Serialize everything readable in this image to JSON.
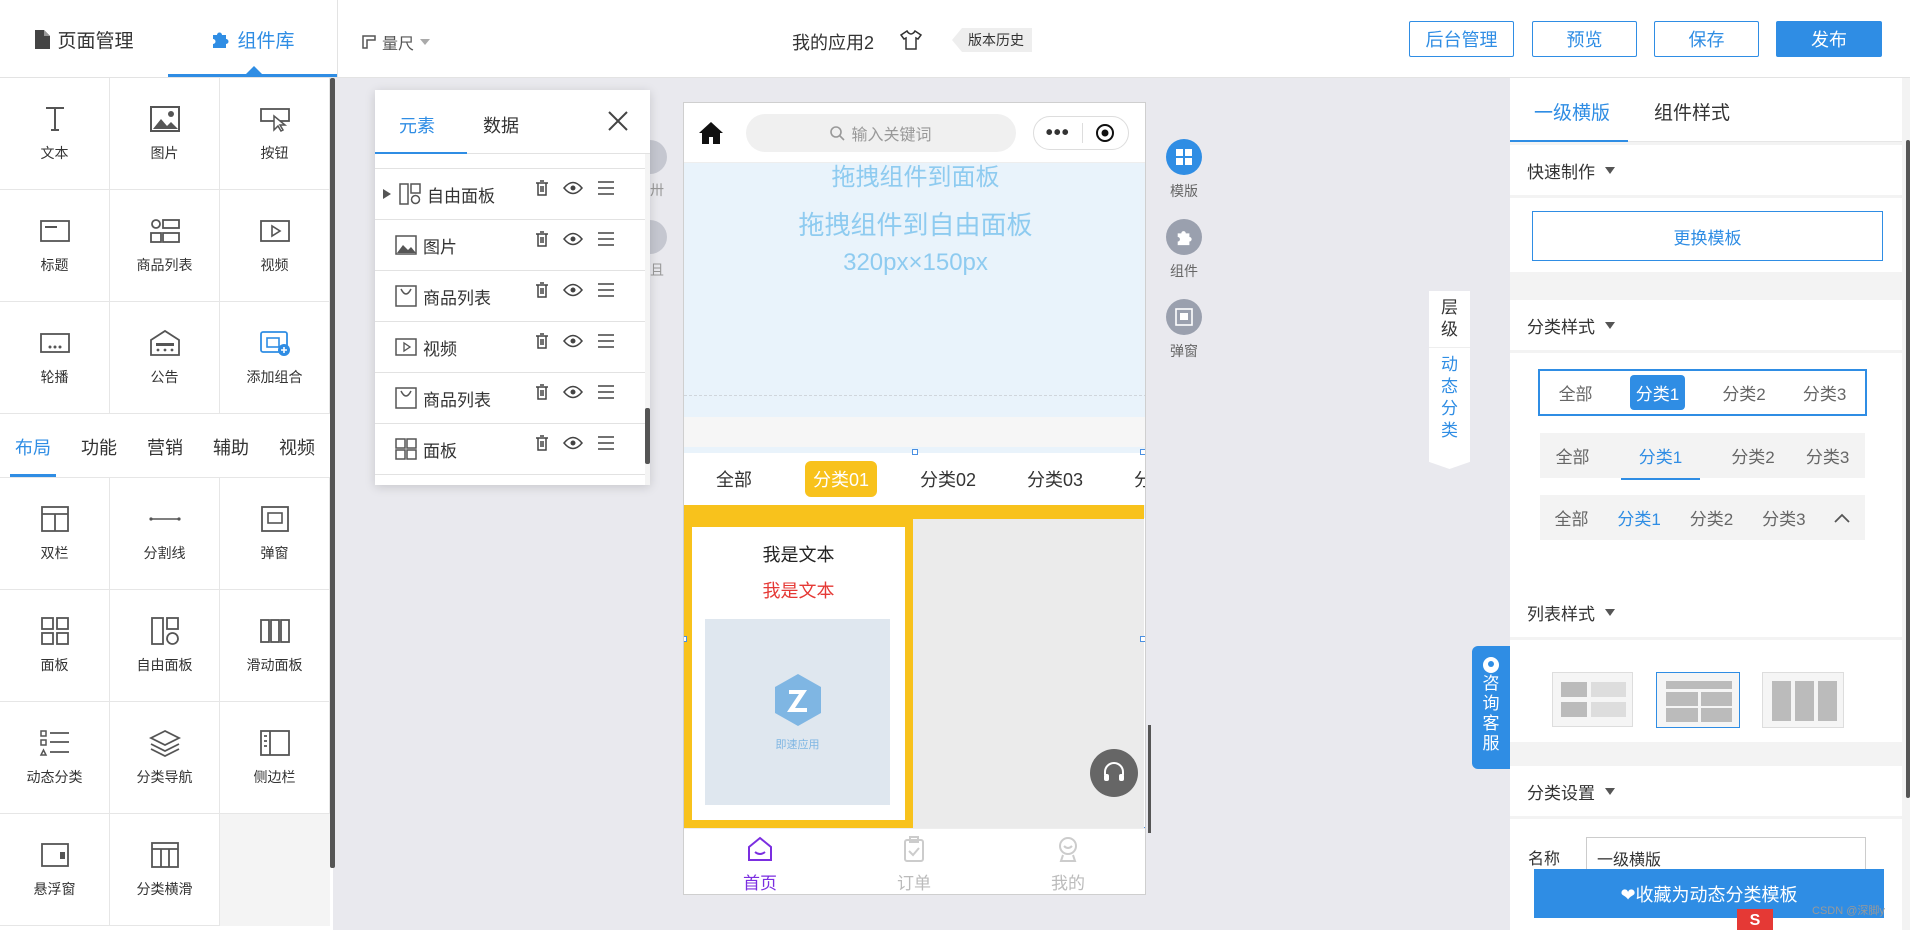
{
  "topbar": {
    "tab_page_manage": "页面管理",
    "tab_component_lib": "组件库",
    "ruler_label": "量尺",
    "app_title": "我的应用2",
    "version_history": "版本历史",
    "btn_admin": "后台管理",
    "btn_preview": "预览",
    "btn_save": "保存",
    "btn_publish": "发布"
  },
  "components": {
    "top": [
      "文本",
      "图片",
      "按钮",
      "标题",
      "商品列表",
      "视频",
      "轮播",
      "公告",
      "添加组合"
    ],
    "categories": [
      "布局",
      "功能",
      "营销",
      "辅助",
      "视频"
    ],
    "layout": [
      "双栏",
      "分割线",
      "弹窗",
      "面板",
      "自由面板",
      "滑动面板",
      "动态分类",
      "分类导航",
      "侧边栏",
      "悬浮窗",
      "分类横滑"
    ]
  },
  "element_panel": {
    "tab_elements": "元素",
    "tab_data": "数据",
    "partial_item": "面板",
    "items": [
      "自由面板",
      "图片",
      "商品列表",
      "视频",
      "商品列表",
      "面板"
    ]
  },
  "phone": {
    "search_placeholder": "输入关键词",
    "drag_hint_top": "拖拽组件到面板",
    "drag_hint": "拖拽组件到自由面板",
    "size_hint": "320px×150px",
    "category_tabs": [
      "全部",
      "分类01",
      "分类02",
      "分类03",
      "分"
    ],
    "card_text_1": "我是文本",
    "card_text_2": "我是文本",
    "logo_text": "即速应用",
    "bottom_nav": [
      "首页",
      "订单",
      "我的"
    ]
  },
  "side_tools": {
    "template": "模版",
    "component": "组件",
    "popup": "弹窗",
    "layer_chars": [
      "层",
      "级"
    ],
    "dynamic_chars": [
      "动",
      "态",
      "分",
      "类"
    ],
    "consult_chars": [
      "咨",
      "询",
      "客",
      "服"
    ],
    "left_cut_1": "卅",
    "left_cut_2": "且"
  },
  "right_panel": {
    "tab_template": "一级横版",
    "tab_style": "组件样式",
    "quick_make": "快速制作",
    "replace_template": "更换模板",
    "category_style": "分类样式",
    "style_tabs": [
      "全部",
      "分类1",
      "分类2",
      "分类3"
    ],
    "list_style": "列表样式",
    "category_settings": "分类设置",
    "name_label": "名称",
    "name_value": "一级横版",
    "favorite_button": "❤收藏为动态分类模板",
    "watermark": "CSDN @深脚y"
  },
  "colors": {
    "accent": "#2f8de4",
    "yellow": "#f8c21c",
    "purple": "#7b2ee0",
    "hint_text": "#8ecbf0"
  }
}
